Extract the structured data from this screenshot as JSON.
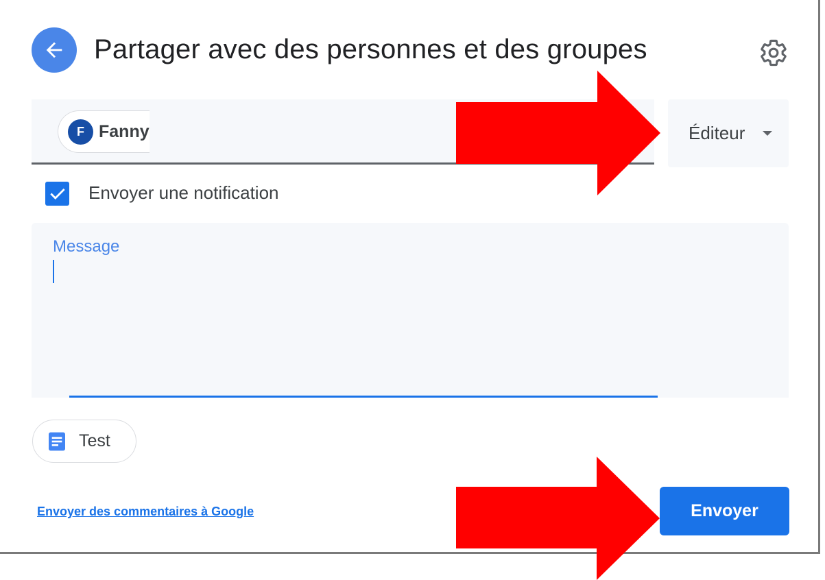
{
  "header": {
    "back_icon": "arrow-left-icon",
    "title": "Partager avec des personnes et des groupes",
    "settings_icon": "gear-icon"
  },
  "recipients": {
    "chips": [
      {
        "avatar_letter": "F",
        "name": "Fanny"
      }
    ]
  },
  "role": {
    "selected": "Éditeur",
    "icon": "caret-down-icon"
  },
  "notification": {
    "checked": true,
    "label": "Envoyer une notification"
  },
  "message": {
    "label": "Message",
    "value": ""
  },
  "attachment": {
    "icon": "document-icon",
    "name": "Test"
  },
  "footer": {
    "feedback_link": "Envoyer des commentaires à Google",
    "send_label": "Envoyer"
  },
  "colors": {
    "accent": "#1a73e8",
    "annotation_arrow": "#ff0000"
  }
}
